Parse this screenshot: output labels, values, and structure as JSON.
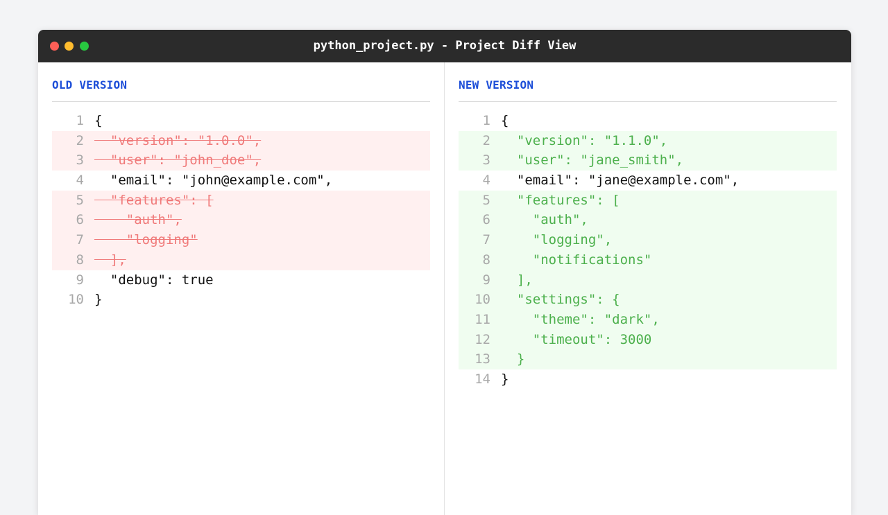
{
  "window": {
    "title": "python_project.py - Project Diff View"
  },
  "colors": {
    "header_accent": "#1d4ed8",
    "removed_text": "#f07a7a",
    "removed_bg": "#fff0f0",
    "added_text": "#4cb04c",
    "added_bg": "#f0fdf0",
    "titlebar_bg": "#2b2b2b"
  },
  "old_version": {
    "header": "OLD VERSION",
    "lines": [
      {
        "num": "1",
        "text": "{",
        "state": "normal"
      },
      {
        "num": "2",
        "text": "  \"version\": \"1.0.0\",",
        "state": "removed"
      },
      {
        "num": "3",
        "text": "  \"user\": \"john_doe\",",
        "state": "removed"
      },
      {
        "num": "4",
        "text": "  \"email\": \"john@example.com\",",
        "state": "normal"
      },
      {
        "num": "5",
        "text": "  \"features\": [",
        "state": "removed"
      },
      {
        "num": "6",
        "text": "    \"auth\",",
        "state": "removed"
      },
      {
        "num": "7",
        "text": "    \"logging\"",
        "state": "removed"
      },
      {
        "num": "8",
        "text": "  ],",
        "state": "removed"
      },
      {
        "num": "9",
        "text": "  \"debug\": true",
        "state": "normal"
      },
      {
        "num": "10",
        "text": "}",
        "state": "normal"
      }
    ]
  },
  "new_version": {
    "header": "NEW VERSION",
    "lines": [
      {
        "num": "1",
        "text": "{",
        "state": "normal"
      },
      {
        "num": "2",
        "text": "  \"version\": \"1.1.0\",",
        "state": "added"
      },
      {
        "num": "3",
        "text": "  \"user\": \"jane_smith\",",
        "state": "added"
      },
      {
        "num": "4",
        "text": "  \"email\": \"jane@example.com\",",
        "state": "normal"
      },
      {
        "num": "5",
        "text": "  \"features\": [",
        "state": "added"
      },
      {
        "num": "6",
        "text": "    \"auth\",",
        "state": "added"
      },
      {
        "num": "7",
        "text": "    \"logging\",",
        "state": "added"
      },
      {
        "num": "8",
        "text": "    \"notifications\"",
        "state": "added"
      },
      {
        "num": "9",
        "text": "  ],",
        "state": "added"
      },
      {
        "num": "10",
        "text": "  \"settings\": {",
        "state": "added"
      },
      {
        "num": "11",
        "text": "    \"theme\": \"dark\",",
        "state": "added"
      },
      {
        "num": "12",
        "text": "    \"timeout\": 3000",
        "state": "added"
      },
      {
        "num": "13",
        "text": "  }",
        "state": "added"
      },
      {
        "num": "14",
        "text": "}",
        "state": "normal"
      }
    ]
  }
}
